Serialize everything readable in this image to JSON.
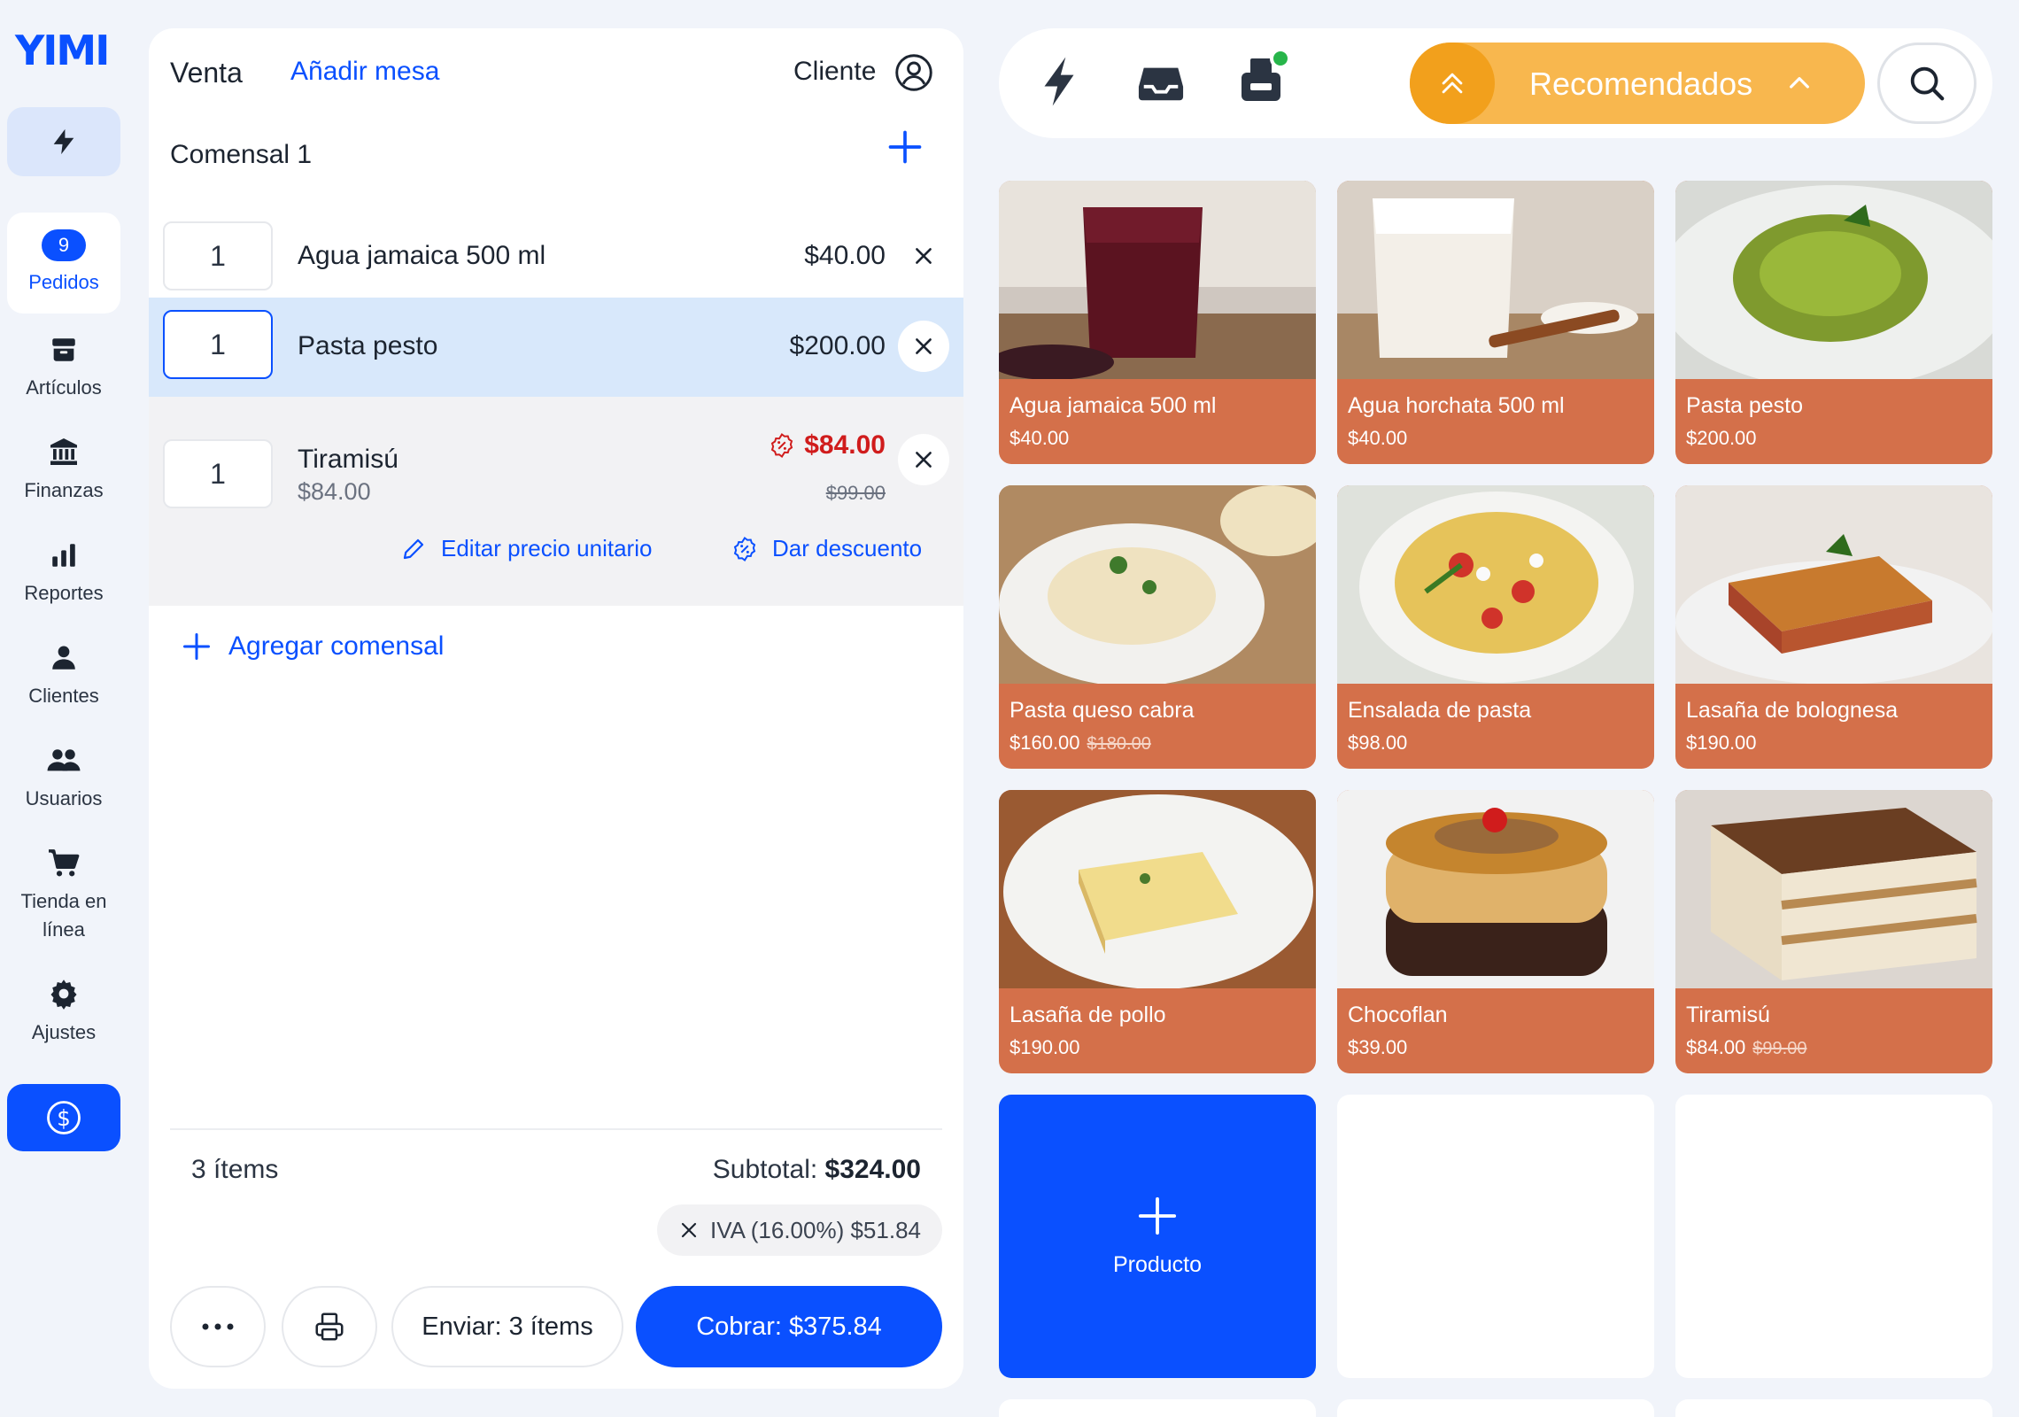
{
  "sidebar": {
    "logo": "YIMI",
    "items": [
      {
        "label": "Pedidos",
        "badge": "9"
      },
      {
        "label": "Artículos"
      },
      {
        "label": "Finanzas"
      },
      {
        "label": "Reportes"
      },
      {
        "label": "Clientes"
      },
      {
        "label": "Usuarios"
      },
      {
        "label": "Tienda en línea"
      },
      {
        "label": "Ajustes"
      }
    ]
  },
  "order": {
    "title": "Venta",
    "add_table": "Añadir mesa",
    "client_label": "Cliente",
    "diner": "Comensal 1",
    "lines": [
      {
        "qty": "1",
        "name": "Agua jamaica 500 ml",
        "price": "$40.00"
      },
      {
        "qty": "1",
        "name": "Pasta pesto",
        "price": "$200.00"
      },
      {
        "qty": "1",
        "name": "Tiramisú",
        "unit_price": "$84.00",
        "price": "$84.00",
        "old_price": "$99.00",
        "edit_price": "Editar precio unitario",
        "discount": "Dar descuento"
      }
    ],
    "add_diner": "Agregar comensal",
    "item_count": "3 ítems",
    "subtotal_label": "Subtotal:",
    "subtotal_value": "$324.00",
    "tax": "IVA (16.00%) $51.84",
    "send_label": "Enviar: 3 ítems",
    "pay_label": "Cobrar: $375.84"
  },
  "topbar": {
    "recommended": "Recomendados"
  },
  "products": [
    {
      "name": "Agua jamaica 500 ml",
      "price": "$40.00",
      "old_price": ""
    },
    {
      "name": "Agua horchata 500 ml",
      "price": "$40.00",
      "old_price": ""
    },
    {
      "name": "Pasta pesto",
      "price": "$200.00",
      "old_price": ""
    },
    {
      "name": "Pasta queso cabra",
      "price": "$160.00",
      "old_price": "$180.00"
    },
    {
      "name": "Ensalada de pasta",
      "price": "$98.00",
      "old_price": ""
    },
    {
      "name": "Lasaña de bolognesa",
      "price": "$190.00",
      "old_price": ""
    },
    {
      "name": "Lasaña de pollo",
      "price": "$190.00",
      "old_price": ""
    },
    {
      "name": "Chocoflan",
      "price": "$39.00",
      "old_price": ""
    },
    {
      "name": "Tiramisú",
      "price": "$84.00",
      "old_price": "$99.00"
    }
  ],
  "add_product": "Producto",
  "colors": {
    "primary": "#0a50ff",
    "card": "#d4704a",
    "accent": "#f2a01c",
    "discount": "#d01c1c"
  }
}
